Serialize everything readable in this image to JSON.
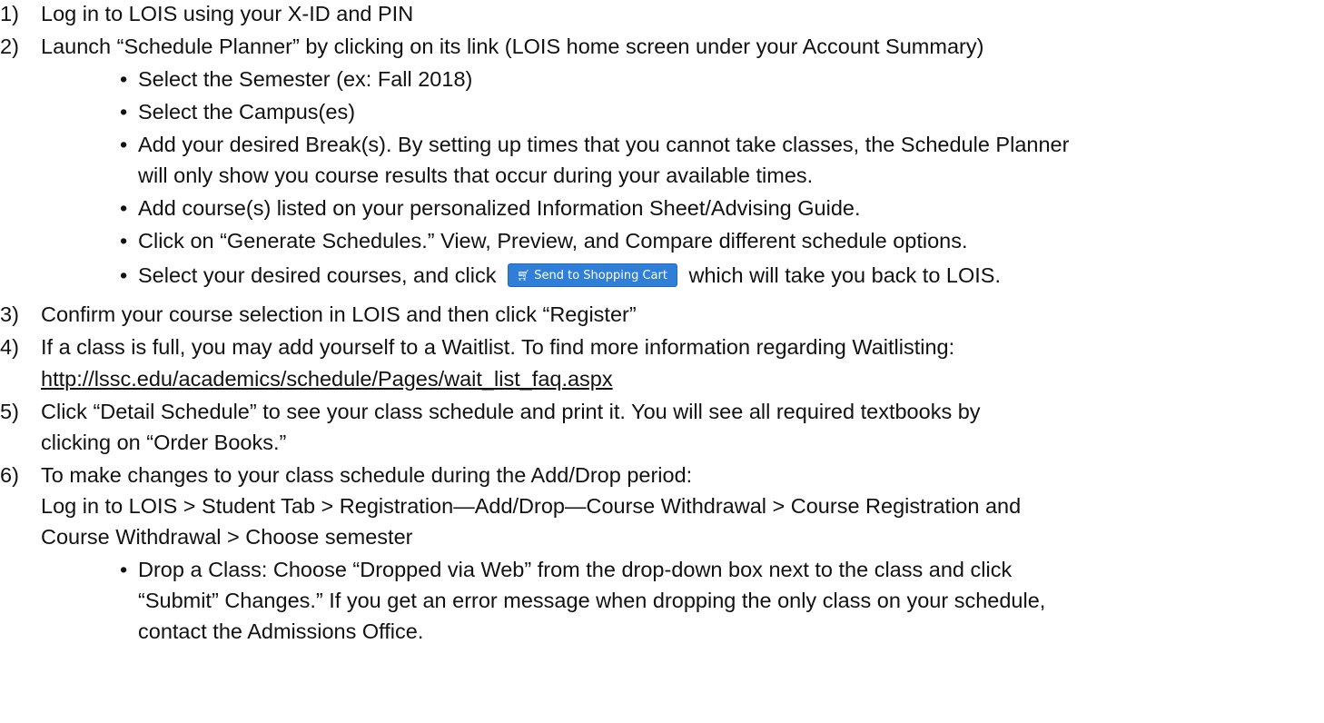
{
  "steps": [
    {
      "number": "1)",
      "text": "Log in to LOIS using your X-ID and PIN"
    },
    {
      "number": "2)",
      "text": "Launch “Schedule Planner” by clicking on its link (LOIS home screen under your Account Summary)"
    },
    {
      "number": "3)",
      "text": "Confirm your course selection in LOIS and then click “Register”"
    },
    {
      "number": "4)",
      "text_line1": "If a class is full, you may add yourself to a Waitlist.  To find more information regarding Waitlisting:",
      "link": "http://lssc.edu/academics/schedule/Pages/wait_list_faq.aspx"
    },
    {
      "number": "5)",
      "text_line1": "Click “Detail Schedule” to see your class schedule and print it.  You will see all required textbooks by",
      "text_line2": "clicking on “Order Books.”"
    },
    {
      "number": "6)",
      "text_line1": "To make changes to your class schedule during the Add/Drop period:",
      "text_line2": "Log in to LOIS > Student Tab > Registration—Add/Drop—Course Withdrawal > Course Registration and",
      "text_line3": "Course Withdrawal > Choose semester"
    }
  ],
  "step2_bullets": [
    {
      "text": "Select the Semester (ex: Fall 2018)"
    },
    {
      "text": "Select the Campus(es)"
    },
    {
      "text_line1": "Add your desired Break(s).  By setting up times that you cannot take classes, the Schedule Planner",
      "text_line2": "will only show you course results that occur during your available times."
    },
    {
      "text": "Add course(s) listed on your personalized Information Sheet/Advising Guide."
    },
    {
      "text": "Click on “Generate Schedules.” View, Preview, and Compare different schedule options."
    },
    {
      "text_before": "Select your desired courses, and click",
      "button_label": "Send to Shopping Cart",
      "button_icon": "shopping-cart-icon",
      "text_after": "which will take you back to LOIS."
    }
  ],
  "step6_bullets": [
    {
      "text_line1": "Drop a Class: Choose “Dropped via Web” from the drop-down box next to the class and click",
      "text_line2": "“Submit” Changes.”  If you get an error message when dropping the only class on your schedule,",
      "text_line3": "contact the Admissions Office."
    }
  ],
  "bullet_symbol": "•",
  "colors": {
    "button_bg": "#2f7ed8",
    "text": "#111111"
  }
}
